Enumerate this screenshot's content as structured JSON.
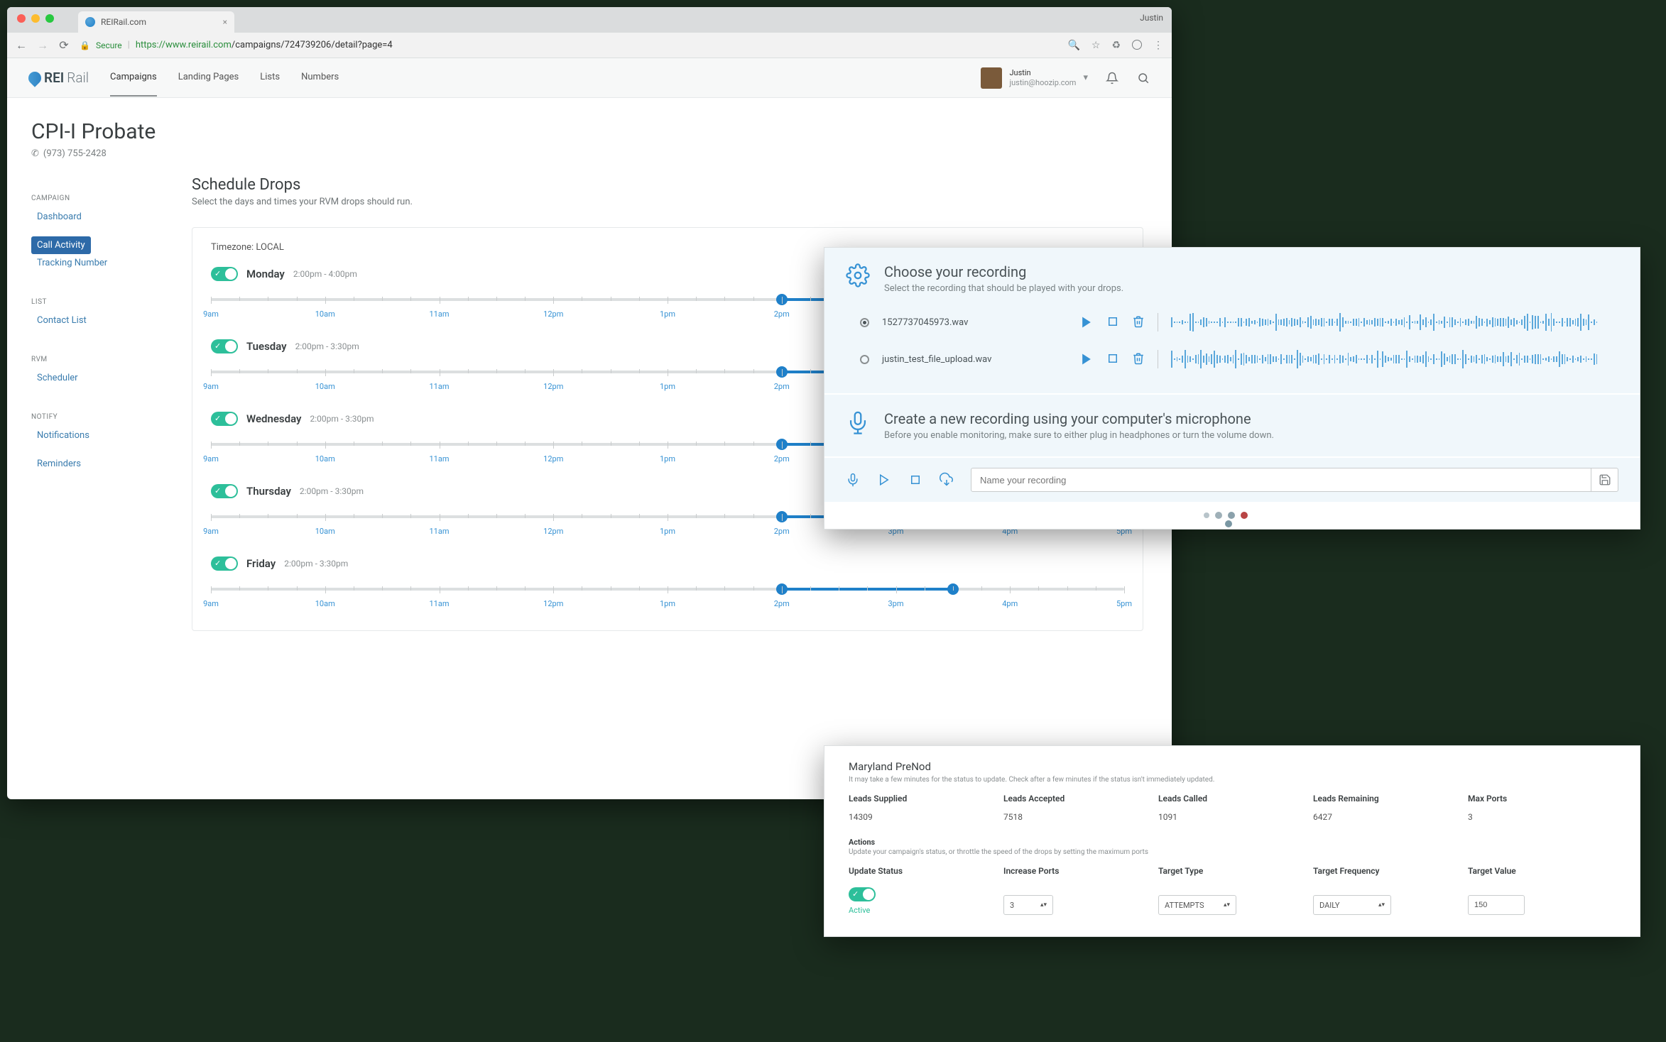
{
  "browser": {
    "profile": "Justin",
    "tab_title": "REIRail.com",
    "url_secure_label": "Secure",
    "url_prefix": "https://",
    "url_host": "www.reirail.com",
    "url_path": "/campaigns/724739206/detail?page=4"
  },
  "app": {
    "logo_primary": "REI",
    "logo_secondary": "Rail",
    "nav": [
      "Campaigns",
      "Landing Pages",
      "Lists",
      "Numbers"
    ],
    "user": {
      "name": "Justin",
      "email": "justin@hoozip.com"
    }
  },
  "page": {
    "title": "CPI-I Probate",
    "phone": "(973) 755-2428"
  },
  "sidebar": {
    "groups": [
      {
        "title": "CAMPAIGN",
        "items": [
          {
            "label": "Dashboard",
            "active": false
          },
          {
            "label": "Call Activity",
            "active": true
          },
          {
            "label": "Tracking Number",
            "active": false
          }
        ]
      },
      {
        "title": "LIST",
        "items": [
          {
            "label": "Contact List",
            "active": false
          }
        ]
      },
      {
        "title": "RVM",
        "items": [
          {
            "label": "Scheduler",
            "active": false
          }
        ]
      },
      {
        "title": "NOTIFY",
        "items": [
          {
            "label": "Notifications",
            "active": false
          },
          {
            "label": "Reminders",
            "active": false
          }
        ]
      }
    ]
  },
  "schedule": {
    "title": "Schedule Drops",
    "subtitle": "Select the days and times your RVM drops should run.",
    "timezone_label": "Timezone: LOCAL",
    "axis": [
      "9am",
      "10am",
      "11am",
      "12pm",
      "1pm",
      "2pm",
      "3pm",
      "4pm",
      "5pm"
    ],
    "days": [
      {
        "name": "Monday",
        "range": "2:00pm - 4:00pm",
        "start_idx": 5,
        "end_idx": 7
      },
      {
        "name": "Tuesday",
        "range": "2:00pm - 3:30pm",
        "start_idx": 5,
        "end_idx": 6.5
      },
      {
        "name": "Wednesday",
        "range": "2:00pm - 3:30pm",
        "start_idx": 5,
        "end_idx": 6.5
      },
      {
        "name": "Thursday",
        "range": "2:00pm - 3:30pm",
        "start_idx": 5,
        "end_idx": 6.5
      },
      {
        "name": "Friday",
        "range": "2:00pm - 3:30pm",
        "start_idx": 5,
        "end_idx": 6.5
      }
    ]
  },
  "recording": {
    "choose_title": "Choose your recording",
    "choose_sub": "Select the recording that should be played with your drops.",
    "files": [
      {
        "name": "1527737045973.wav",
        "selected": true
      },
      {
        "name": "justin_test_file_upload.wav",
        "selected": false
      }
    ],
    "create_title": "Create a new recording using your computer's microphone",
    "create_sub": "Before you enable monitoring, make sure to either plug in headphones or turn the volume down.",
    "name_placeholder": "Name your recording"
  },
  "stats": {
    "title": "Maryland PreNod",
    "hint": "It may take a few minutes for the status to update. Check after a few minutes if the status isn't immediately updated.",
    "cols": [
      "Leads Supplied",
      "Leads Accepted",
      "Leads Called",
      "Leads Remaining",
      "Max Ports"
    ],
    "vals": [
      "14309",
      "7518",
      "1091",
      "6427",
      "3"
    ],
    "actions_title": "Actions",
    "actions_hint": "Update your campaign's status, or throttle the speed of the drops by setting the maximum ports",
    "action_cols": [
      "Update Status",
      "Increase Ports",
      "Target Type",
      "Target Frequency",
      "Target Value"
    ],
    "status_label": "Active",
    "ports_value": "3",
    "target_type": "ATTEMPTS",
    "target_freq": "DAILY",
    "target_value": "150"
  }
}
